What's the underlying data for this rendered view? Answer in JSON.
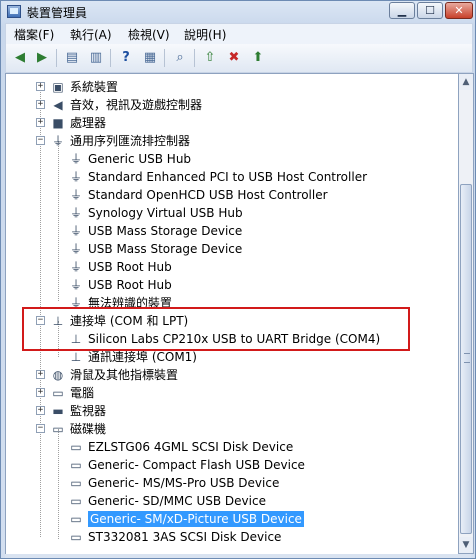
{
  "window": {
    "title": "裝置管理員"
  },
  "menu": [
    "檔案(F)",
    "執行(A)",
    "檢視(V)",
    "說明(H)"
  ],
  "toolbar_icons": [
    "back-icon",
    "forward-icon",
    "properties-icon",
    "help-icon",
    "view-icon",
    "scan-icon",
    "update-driver-icon",
    "uninstall-icon",
    "enable-icon"
  ],
  "tree": [
    {
      "label": "系統裝置",
      "icon": "system-icon",
      "expander": "+"
    },
    {
      "label": "音效，視訊及遊戲控制器",
      "icon": "sound-icon",
      "expander": "+"
    },
    {
      "label": "處理器",
      "icon": "processor-icon",
      "expander": "+"
    },
    {
      "label": "通用序列匯流排控制器",
      "icon": "usb-icon",
      "expander": "-"
    },
    {
      "label": "Generic USB Hub",
      "icon": "usb-icon"
    },
    {
      "label": "Standard Enhanced PCI to USB Host Controller",
      "icon": "usb-icon"
    },
    {
      "label": "Standard OpenHCD USB Host Controller",
      "icon": "usb-icon"
    },
    {
      "label": "Synology Virtual USB Hub",
      "icon": "usb-icon"
    },
    {
      "label": "USB Mass Storage Device",
      "icon": "usb-icon"
    },
    {
      "label": "USB Mass Storage Device",
      "icon": "usb-icon"
    },
    {
      "label": "USB Root Hub",
      "icon": "usb-icon"
    },
    {
      "label": "USB Root Hub",
      "icon": "usb-icon"
    },
    {
      "label": "無法辨識的裝置",
      "icon": "usb-icon"
    },
    {
      "label": "連接埠 (COM 和 LPT)",
      "icon": "port-icon",
      "expander": "-"
    },
    {
      "label": "Silicon Labs CP210x USB to UART Bridge (COM4)",
      "icon": "port-icon"
    },
    {
      "label": "通訊連接埠 (COM1)",
      "icon": "port-icon"
    },
    {
      "label": "滑鼠及其他指標裝置",
      "icon": "mouse-icon",
      "expander": "+"
    },
    {
      "label": "電腦",
      "icon": "computer-icon",
      "expander": "+"
    },
    {
      "label": "監視器",
      "icon": "monitor-icon",
      "expander": "+"
    },
    {
      "label": "磁碟機",
      "icon": "disk-icon",
      "expander": "-"
    },
    {
      "label": "EZLSTG06 4GML SCSI Disk Device",
      "icon": "disk-icon"
    },
    {
      "label": "Generic- Compact Flash USB Device",
      "icon": "disk-icon"
    },
    {
      "label": "Generic- MS/MS-Pro USB Device",
      "icon": "disk-icon"
    },
    {
      "label": "Generic- SD/MMC USB Device",
      "icon": "disk-icon"
    },
    {
      "label": "Generic- SM/xD-Picture USB Device",
      "icon": "disk-icon",
      "selected": true
    },
    {
      "label": "ST332081 3AS SCSI Disk Device",
      "icon": "disk-icon"
    }
  ],
  "highlight_color": "#d21a1a",
  "selection_color": "#3399ff"
}
